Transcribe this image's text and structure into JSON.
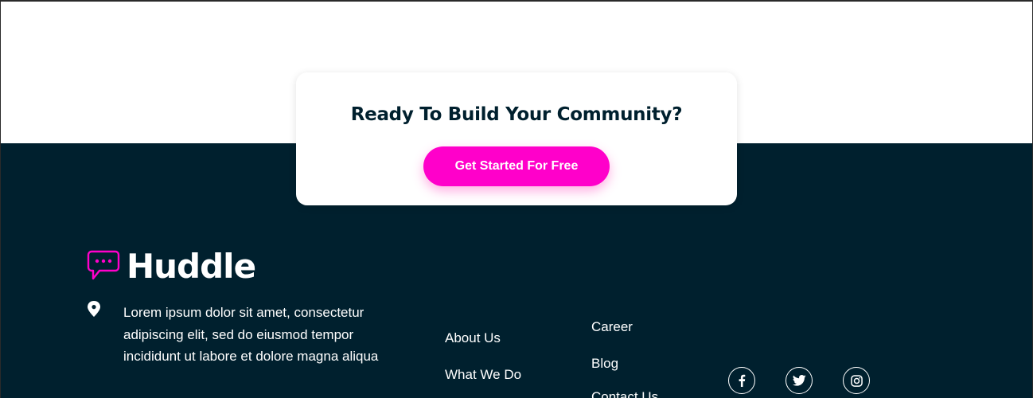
{
  "cta": {
    "title": "Ready To Build Your Community?",
    "button_label": "Get Started For Free"
  },
  "footer": {
    "brand": "Huddle",
    "address": "Lorem ipsum dolor sit amet, consectetur adipiscing elit, sed do eiusmod tempor incididunt ut labore et dolore magna aliqua",
    "links_col1": [
      "About Us",
      "What We Do"
    ],
    "links_col2": [
      "Career",
      "Blog",
      "Contact Us"
    ],
    "social": [
      "facebook-icon",
      "twitter-icon",
      "instagram-icon"
    ]
  },
  "colors": {
    "footer_bg": "#00202e",
    "accent": "#ff00ca",
    "text_dark": "#00202e",
    "text_light": "#ffffff"
  }
}
